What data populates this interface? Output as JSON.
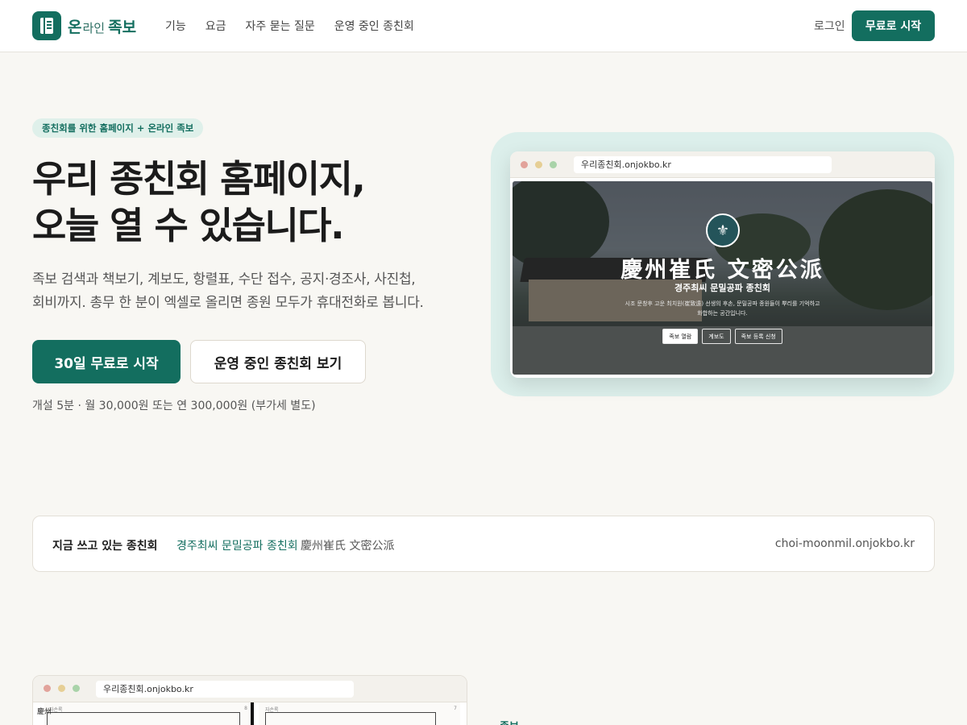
{
  "header": {
    "logo_on": "온",
    "logo_rain": "라인",
    "logo_jokbo": "족보",
    "nav": [
      "기능",
      "요금",
      "자주 묻는 질문",
      "운영 중인 종친회"
    ],
    "login": "로그인",
    "cta": "무료로 시작"
  },
  "hero": {
    "badge": "종친회를 위한 홈페이지 + 온라인 족보",
    "title_line1": "우리 종친회 홈페이지,",
    "title_line2": "오늘 열 수 있습니다.",
    "desc_line1": "족보 검색과 책보기, 계보도, 항렬표, 수단 접수, 공지·경조사, 사진첩,",
    "desc_line2": "회비까지. 총무 한 분이 엑셀로 올리면 종원 모두가 휴대전화로 봅니다.",
    "primary_button": "30일 무료로 시작",
    "secondary_button": "운영 중인 종친회 보기",
    "note": "개설 5분 · 월 30,000원 또는 연 300,000원 (부가세 별도)"
  },
  "preview": {
    "url": "우리종친회.onjokbo.kr",
    "title": "慶州崔氏 文密公派",
    "subtitle": "경주최씨 문밀공파 종친회",
    "desc_line1": "시조 문창후 고운 최치원(崔致遠) 선생의 후손, 문밀공파 종원들이 뿌리를 기억하고",
    "desc_line2": "화합하는 공간입니다.",
    "buttons": [
      "족보 열람",
      "계보도",
      "족보 등록 신청"
    ]
  },
  "in_use": {
    "label": "지금 쓰고 있는 종친회",
    "name": "경주최씨 문밀공파 종친회",
    "hanja": "慶州崔氏 文密公派",
    "url": "choi-moonmil.onjokbo.kr"
  },
  "bottom_preview": {
    "url": "우리종친회.onjokbo.kr",
    "page_left_label": "자손록",
    "page_left_num": "8",
    "page_right_label": "자손록",
    "page_right_num": "7",
    "side_hanja": "慶州",
    "section_label": "족보"
  },
  "colors": {
    "brand": "#136e5f",
    "background": "#f8f7f3",
    "badge_bg": "#dff0ea",
    "halo": "#dcefeb"
  }
}
